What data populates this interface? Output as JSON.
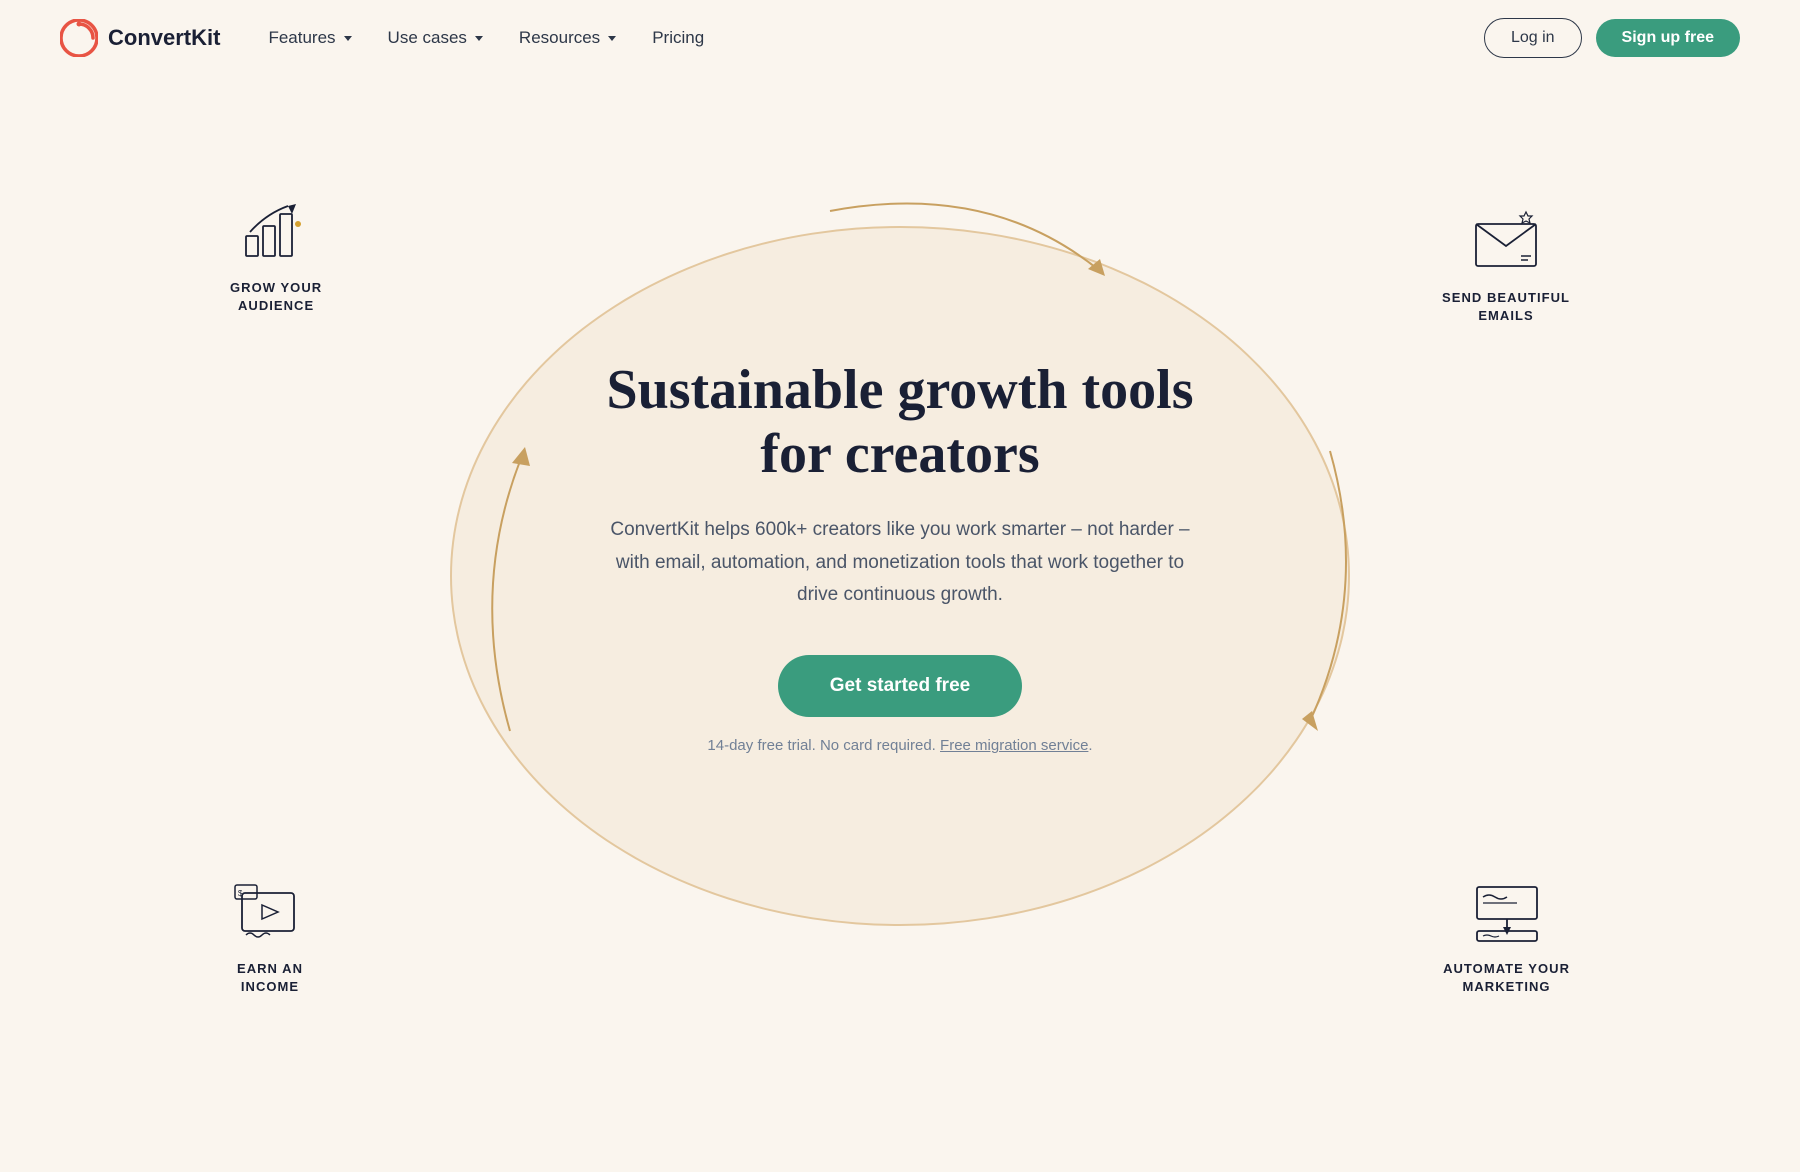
{
  "nav": {
    "logo_text": "ConvertKit",
    "links": [
      {
        "label": "Features",
        "has_dropdown": true
      },
      {
        "label": "Use cases",
        "has_dropdown": true
      },
      {
        "label": "Resources",
        "has_dropdown": true
      },
      {
        "label": "Pricing",
        "has_dropdown": false
      }
    ],
    "login_label": "Log in",
    "signup_label": "Sign up free"
  },
  "hero": {
    "title": "Sustainable growth tools for creators",
    "subtitle": "ConvertKit helps 600k+ creators like you work smarter – not harder – with email, automation, and monetization tools that work together to drive continuous growth.",
    "cta_label": "Get started free",
    "fine_print": "14-day free trial. No card required.",
    "migration_link": "Free migration service"
  },
  "features": [
    {
      "id": "grow",
      "label": "GROW YOUR\nAUDIENCE",
      "icon": "chart"
    },
    {
      "id": "email",
      "label": "SEND BEAUTIFUL\nEMAILS",
      "icon": "envelope"
    },
    {
      "id": "income",
      "label": "EARN AN\nINCOME",
      "icon": "card"
    },
    {
      "id": "automate",
      "label": "AUTOMATE YOUR\nMARKETING",
      "icon": "monitor"
    }
  ],
  "colors": {
    "brand_teal": "#3a9c7e",
    "nav_dark": "#1a2035",
    "body_bg": "#faf5ee",
    "oval_bg": "#f5e9d8",
    "oval_border": "#d4a96a",
    "text_muted": "#718096",
    "logo_red": "#e85444"
  }
}
